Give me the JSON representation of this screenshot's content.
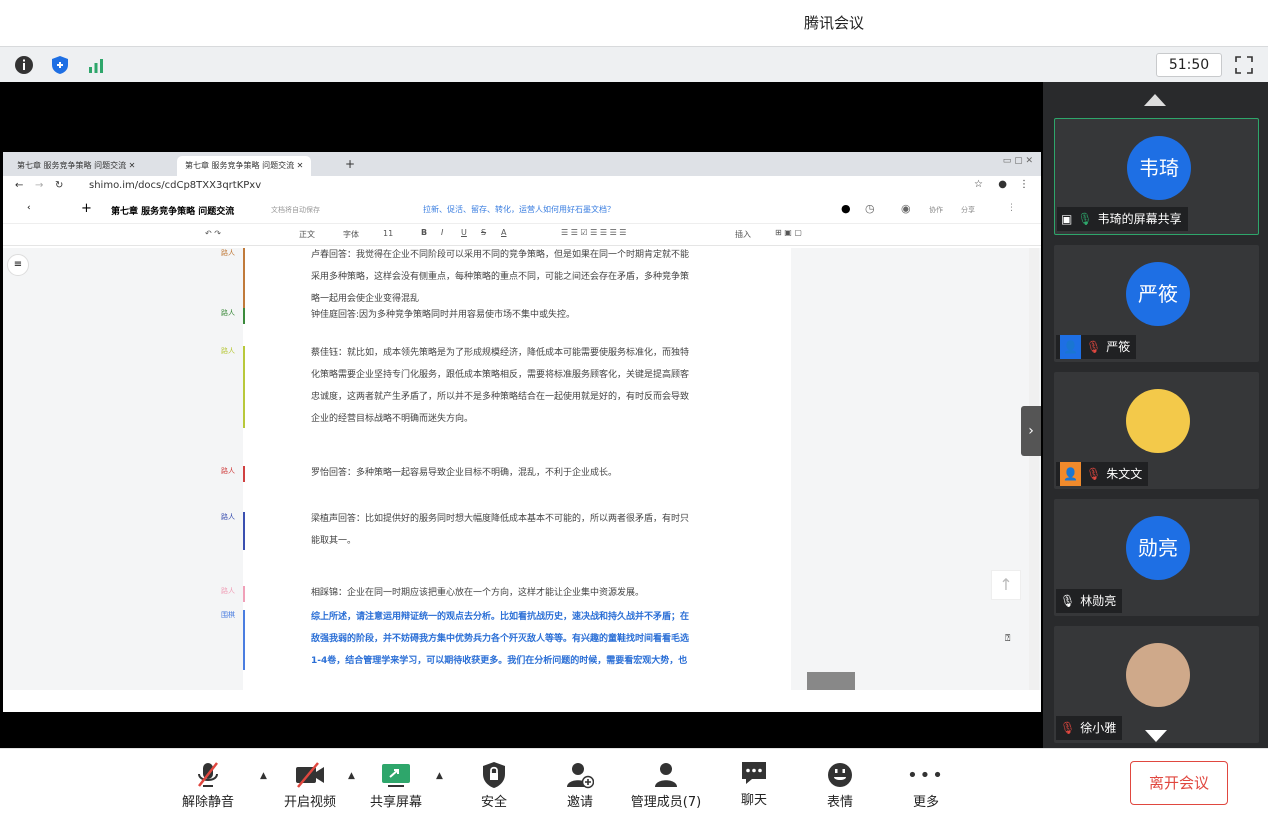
{
  "window": {
    "title": "腾讯会议"
  },
  "status": {
    "timer": "51:50"
  },
  "browser": {
    "tabs": [
      "第七章 服务竞争策略 问题交流",
      "第七章 服务竞争策略 问题交流"
    ],
    "url": "shimo.im/docs/cdCp8TXX3qrtKPxv"
  },
  "doc": {
    "title": "第七章 服务竞争策略 问题交流",
    "autosave": "文档将自动保存",
    "banner": "拉新、促活、留存、转化，运营人如何用好石墨文档？",
    "collab_label": "协作",
    "share_label": "分享",
    "toolbar": [
      "正文",
      "字体",
      "11",
      "B",
      "I",
      "U",
      "S",
      "A",
      "插入"
    ],
    "paragraphs": [
      {
        "label": "路人",
        "color": "#c07a3a",
        "lines": [
          "卢春回答：我觉得在企业不同阶段可以采用不同的竞争策略，但是如果在同一个时期肯定就不能",
          "采用多种策略，这样会没有侧重点，每种策略的重点不同，可能之间还会存在矛盾，多种竞争策",
          "略一起用会使企业变得混乱"
        ]
      },
      {
        "label": "路人",
        "color": "#3b8a3b",
        "lines": [
          "钟佳庭回答:因为多种竞争策略同时并用容易使市场不集中或失控。"
        ]
      },
      {
        "label": "路人",
        "color": "#b8c83a",
        "lines": [
          "蔡佳钰：就比如，成本领先策略是为了形成规模经济，降低成本可能需要使服务标准化，而独特",
          "化策略需要企业坚持专门化服务，跟低成本策略相反，需要将标准服务顾客化，关键是提高顾客",
          "忠诚度，这两者就产生矛盾了，所以并不是多种策略结合在一起使用就是好的，有时反而会导致",
          "企业的经营目标战略不明确而迷失方向。"
        ]
      },
      {
        "label": "路人",
        "color": "#d04040",
        "lines": [
          "罗怡回答：多种策略一起容易导致企业目标不明确，混乱，不利于企业成长。"
        ]
      },
      {
        "label": "路人",
        "color": "#3a4fb0",
        "lines": [
          "梁植声回答：比如提供好的服务同时想大幅度降低成本基本不可能的，所以两者很矛盾，有时只",
          "能取其一。"
        ]
      },
      {
        "label": "路人",
        "color": "#f0a0b8",
        "lines": [
          "相踩锦：企业在同一时期应该把重心放在一个方向，这样才能让企业集中资源发展。"
        ]
      },
      {
        "label": "围棋",
        "color": "#4a7de0",
        "blue": true,
        "lines": [
          "综上所述，请注意运用辩证统一的观点去分析。比如看抗战历史，速决战和持久战并不矛盾；在",
          "敌强我弱的阶段，并不妨碍我方集中优势兵力各个歼灭敌人等等。有兴趣的童鞋找时间看看毛选",
          "1-4卷，结合管理学来学习，可以期待收获更多。我们在分析问题的时候，需要看宏观大势，也"
        ]
      }
    ]
  },
  "participants": [
    {
      "avatar_text": "韦琦",
      "name": "韦琦的屏幕共享",
      "avatar_color": "#1e6fe4",
      "sharing": true
    },
    {
      "avatar_text": "严筱",
      "name": "严筱",
      "avatar_color": "#1e6fe4",
      "muted": true
    },
    {
      "avatar_text": "",
      "name": "朱文文",
      "avatar_color": "#f3c94a",
      "muted": true
    },
    {
      "avatar_text": "勋亮",
      "name": "林勋亮",
      "avatar_color": "#1e6fe4"
    },
    {
      "avatar_text": "",
      "name": "徐小雅",
      "avatar_color": "#cfa98a",
      "muted": true
    }
  ],
  "bottom": {
    "unmute": "解除静音",
    "video": "开启视频",
    "share": "共享屏幕",
    "security": "安全",
    "invite": "邀请",
    "members": "管理成员(7)",
    "chat": "聊天",
    "reactions": "表情",
    "more": "更多",
    "leave": "离开会议"
  }
}
